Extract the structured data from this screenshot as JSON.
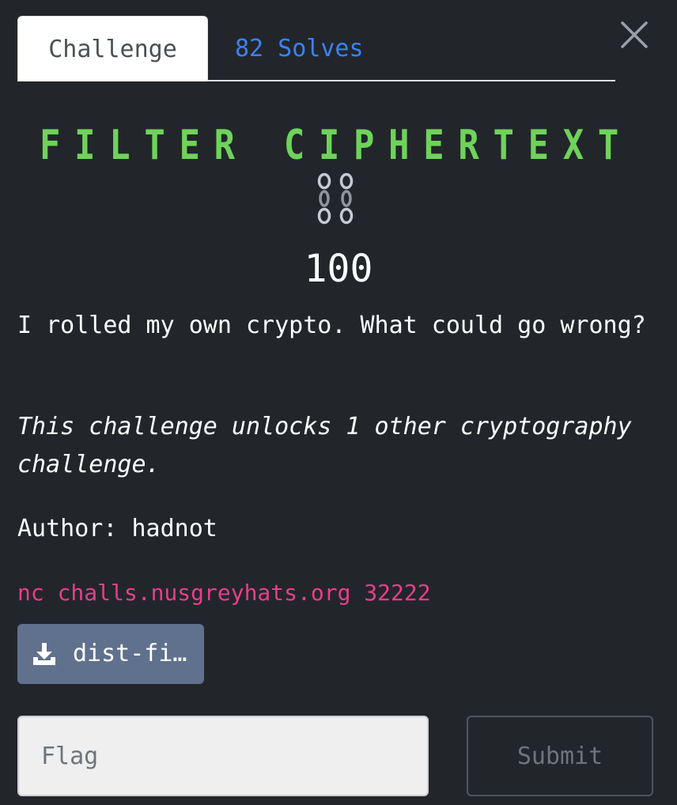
{
  "tabs": {
    "challenge": "Challenge",
    "solves": "82 Solves"
  },
  "challenge": {
    "title": "FILTER CIPHERTEXT",
    "title_color": "#6fd35a",
    "emoji": "⛓️",
    "emoji_name": "chains-icon",
    "points": "100",
    "description": "I rolled my own crypto. What could go wrong?",
    "unlocks": "This challenge unlocks 1 other cryptography challenge.",
    "author": "Author: hadnot",
    "connection": "nc challs.nusgreyhats.org 32222",
    "file_label": "dist-fi…"
  },
  "form": {
    "flag_placeholder": "Flag",
    "submit_label": "Submit"
  },
  "colors": {
    "background": "#22262b",
    "link_blue": "#3b82f6",
    "code_pink": "#e83e8c",
    "file_button": "#5f718d"
  }
}
